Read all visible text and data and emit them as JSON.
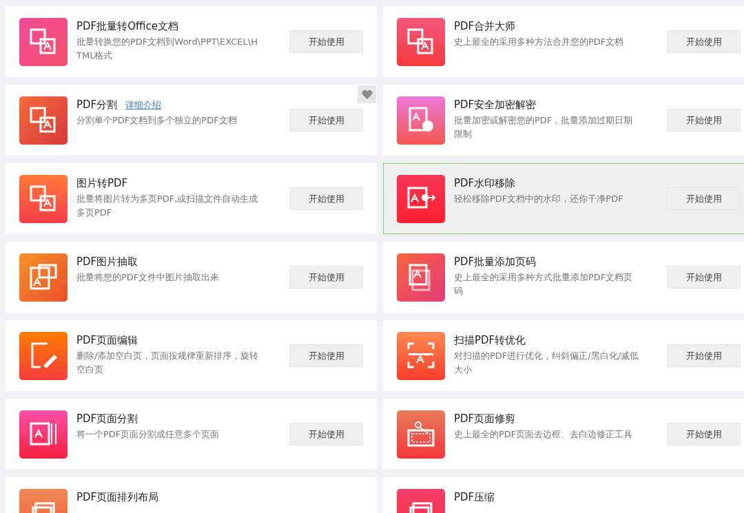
{
  "tools": [
    {
      "title": "PDF批量转Office文档",
      "description": "批量转换您的PDF文档到Word\\PPT\\EXCEL\\HTML格式",
      "button": "开始使用",
      "selected": false,
      "favorite": false
    },
    {
      "title": "PDF合并大师",
      "description": "史上最全的采用多种方法合并您的PDF文档",
      "button": "开始使用",
      "selected": false,
      "favorite": false
    },
    {
      "title": "PDF分割",
      "link": "详细介绍",
      "description": "分割单个PDF文档到多个独立的PDF文档",
      "button": "开始使用",
      "selected": false,
      "favorite": true
    },
    {
      "title": "PDF安全加密解密",
      "description": "批量加密或解密您的PDF，批量添加过期日期限制",
      "button": "开始使用",
      "selected": false,
      "favorite": false
    },
    {
      "title": "图片转PDF",
      "description": "批量将图片转为多页PDF,或扫描文件自动生成多页PDF",
      "button": "开始使用",
      "selected": false,
      "favorite": false
    },
    {
      "title": "PDF水印移除",
      "description": "轻松移除PDF文档中的水印，还你干净PDF",
      "button": "开始使用",
      "selected": true,
      "favorite": false
    },
    {
      "title": "PDF图片抽取",
      "description": "批量将您的PDF文件中图片抽取出来",
      "button": "开始使用",
      "selected": false,
      "favorite": false
    },
    {
      "title": "PDF批量添加页码",
      "description": "史上最全的采用多种方式批量添加PDF文档页码",
      "button": "开始使用",
      "selected": false,
      "favorite": false
    },
    {
      "title": "PDF页面编辑",
      "description": "删除/添加空白页，页面按规律重新排序，旋转空白页",
      "button": "开始使用",
      "selected": false,
      "favorite": false
    },
    {
      "title": "扫描PDF转优化",
      "description": "对扫描的PDF进行优化，纠斜偏正/黑白化/减低大小",
      "button": "开始使用",
      "selected": false,
      "favorite": false
    },
    {
      "title": "PDF页面分割",
      "description": "将一个PDF页面分割成任意多个页面",
      "button": "开始使用",
      "selected": false,
      "favorite": false
    },
    {
      "title": "PDF页面修剪",
      "description": "史上最全的PDF页面去边框、去白边修正工具",
      "button": "开始使用",
      "selected": false,
      "favorite": false
    },
    {
      "title": "PDF页面排列布局",
      "selected": false
    },
    {
      "title": "PDF压缩",
      "selected": false
    }
  ]
}
